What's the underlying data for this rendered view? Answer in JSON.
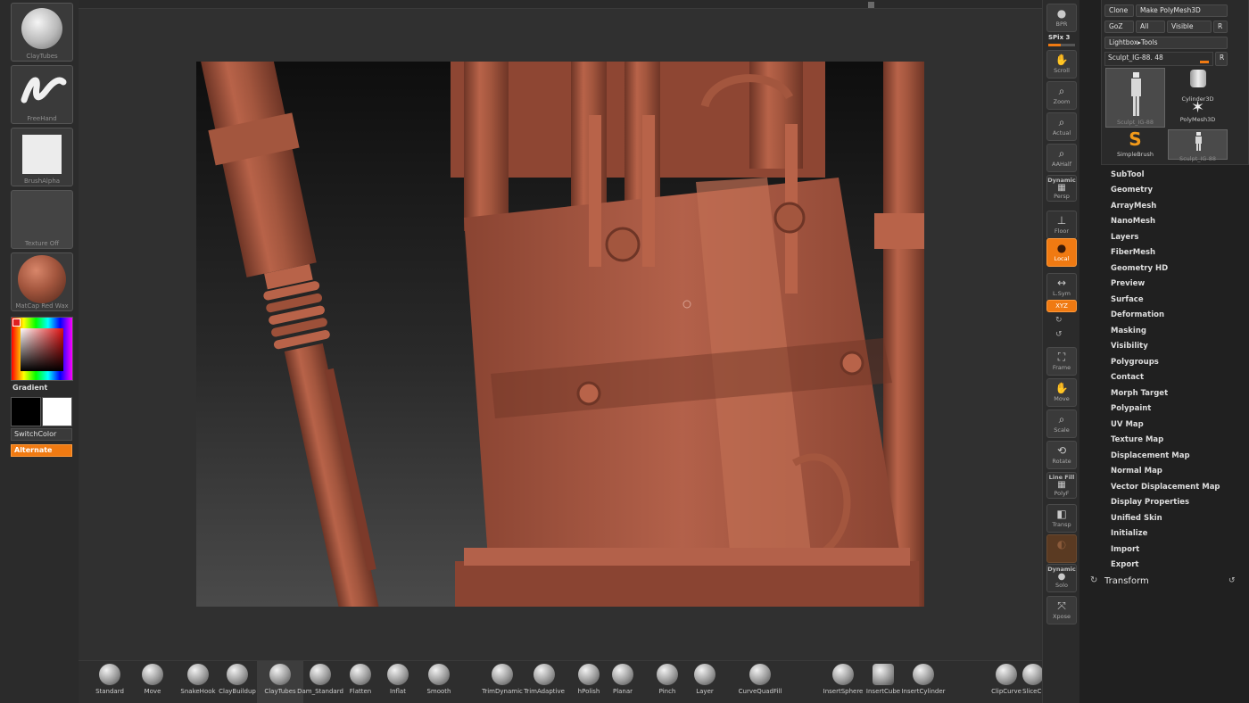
{
  "left_shelf": {
    "brush_caption": "ClayTubes",
    "stroke_caption": "FreeHand",
    "alpha_caption": "BrushAlpha",
    "texture_caption": "Texture Off",
    "material_caption": "MatCap Red Wax",
    "gradient_label": "Gradient",
    "switch_color_label": "SwitchColor",
    "alternate_label": "Alternate"
  },
  "right_toolbar": {
    "bpr": "BPR",
    "spix": "SPix 3",
    "scroll": "Scroll",
    "zoom": "Zoom",
    "actual": "Actual",
    "aahalf": "AAHalf",
    "dynamic": "Dynamic",
    "persp": "Persp",
    "floor": "Floor",
    "local": "Local",
    "lsym": "L.Sym",
    "xyz": "XYZ",
    "frame": "Frame",
    "move": "Move",
    "scale": "Scale",
    "rotate": "Rotate",
    "line_fill": "Line Fill",
    "polyf": "PolyF",
    "transp": "Transp",
    "dynamic2": "Dynamic",
    "solo": "Solo",
    "xpose": "Xpose"
  },
  "tool_panel": {
    "clone": "Clone",
    "make_polymesh": "Make PolyMesh3D",
    "goz": "GoZ",
    "all": "All",
    "visible": "Visible",
    "r": "R",
    "lightbox_tools": "Lightbox▸Tools",
    "current_tool": "Sculpt_IG-88. 48",
    "r2": "R",
    "thumbs": {
      "sculpt_big": "Sculpt_IG-88",
      "cylinder": "Cylinder3D",
      "polymesh": "PolyMesh3D",
      "simplebrush": "SimpleBrush",
      "sculpt_small": "Sculpt_IG-88"
    },
    "menu": [
      "SubTool",
      "Geometry",
      "ArrayMesh",
      "NanoMesh",
      "Layers",
      "FiberMesh",
      "Geometry HD",
      "Preview",
      "Surface",
      "Deformation",
      "Masking",
      "Visibility",
      "Polygroups",
      "Contact",
      "Morph Target",
      "Polypaint",
      "UV Map",
      "Texture Map",
      "Displacement Map",
      "Normal Map",
      "Vector Displacement Map",
      "Display Properties",
      "Unified Skin",
      "Initialize",
      "Import",
      "Export"
    ],
    "transform": "Transform"
  },
  "brushes": [
    "Standard",
    "Move",
    "SnakeHook",
    "ClayBuildup",
    "ClayTubes",
    "Dam_Standard",
    "Flatten",
    "Inflat",
    "Smooth",
    "TrimDynamic",
    "TrimAdaptive",
    "hPolish",
    "Planar",
    "Pinch",
    "Layer",
    "CurveQuadFill",
    "InsertSphere",
    "InsertCube",
    "InsertCylinder",
    "ClipCurve",
    "SliceCurve"
  ],
  "colors": {
    "accent": "#f07a12",
    "clay": "#a3563e",
    "clay_dark": "#6e3526",
    "clay_light": "#c06d52"
  }
}
